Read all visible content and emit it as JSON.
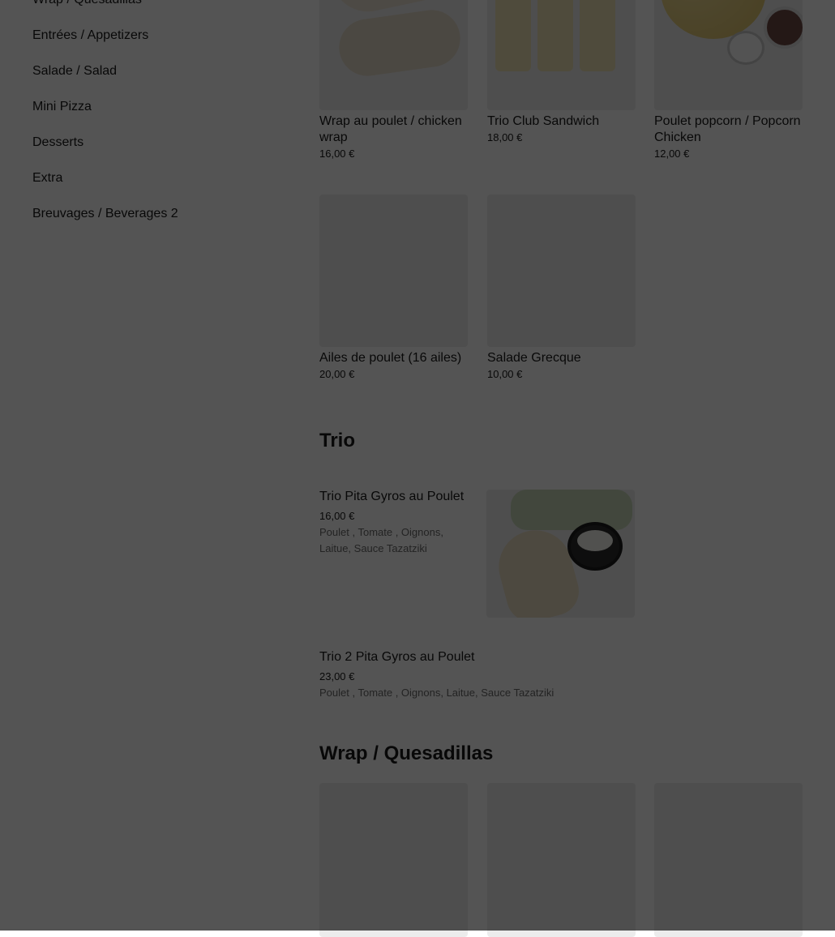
{
  "sidebar": {
    "items": [
      {
        "label": "Wrap / Quesadillas"
      },
      {
        "label": "Entrées / Appetizers"
      },
      {
        "label": "Salade / Salad"
      },
      {
        "label": "Mini Pizza"
      },
      {
        "label": "Desserts"
      },
      {
        "label": "Extra"
      },
      {
        "label": "Breuvages / Beverages 2"
      }
    ]
  },
  "appetizers": {
    "items": [
      {
        "name": "Wrap au poulet / chicken wrap",
        "price": "16,00 €"
      },
      {
        "name": "Trio Club Sandwich",
        "price": "18,00 €"
      },
      {
        "name": "Poulet popcorn / Popcorn Chicken",
        "price": "12,00 €"
      },
      {
        "name": "Ailes de poulet (16 ailes)",
        "price": "20,00 €"
      },
      {
        "name": "Salade Grecque",
        "price": "10,00 €"
      }
    ]
  },
  "trio": {
    "title": "Trio",
    "items": [
      {
        "name": "Trio Pita Gyros au Poulet",
        "price": "16,00 €",
        "desc": "Poulet , Tomate , Oignons, Laitue, Sauce Tazatziki"
      },
      {
        "name": "Trio 2 Pita Gyros au Poulet",
        "price": "23,00 €",
        "desc": "Poulet , Tomate , Oignons, Laitue, Sauce Tazatziki"
      }
    ]
  },
  "wrap_section": {
    "title": "Wrap / Quesadillas"
  }
}
